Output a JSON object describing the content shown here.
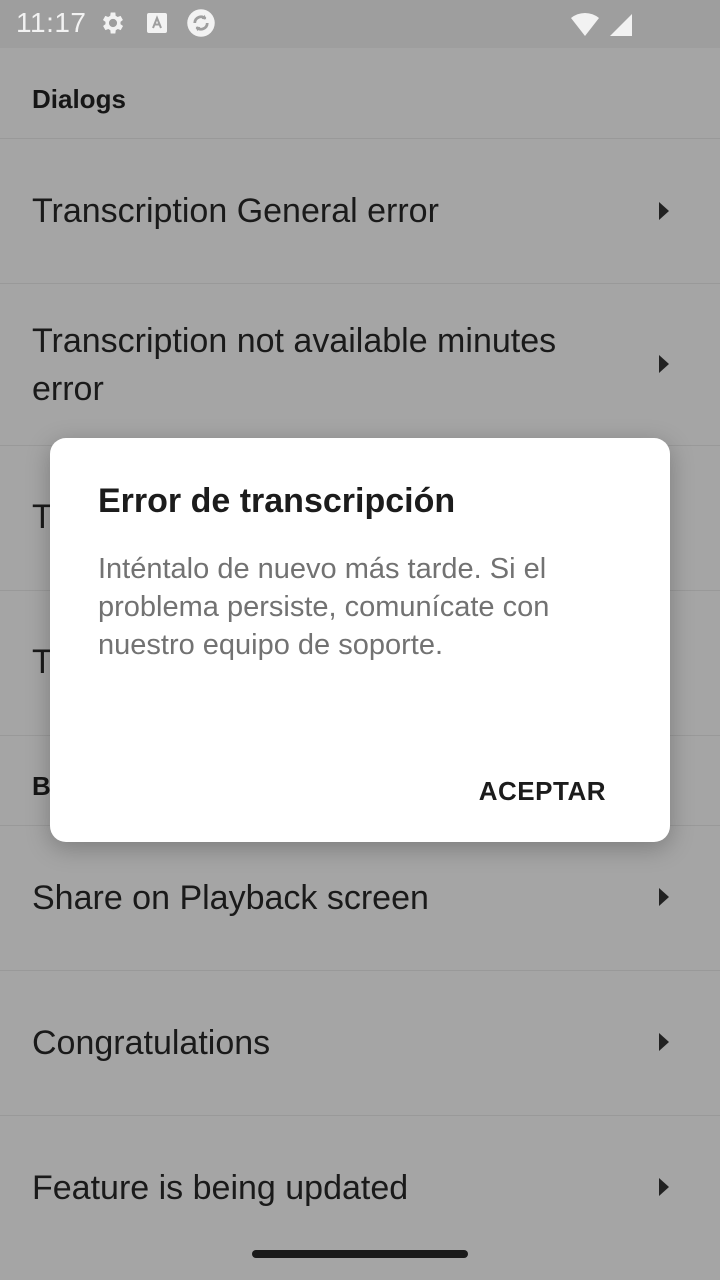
{
  "status_bar": {
    "time": "11:17",
    "icons_left": [
      "settings-gear-icon",
      "keyboard-a-icon",
      "sync-circle-icon"
    ],
    "icons_right": [
      "wifi-icon",
      "cell-signal-icon"
    ]
  },
  "list": {
    "categories": [
      {
        "label": "Dialogs"
      },
      {
        "label": "B"
      }
    ],
    "items": [
      {
        "label": "Transcription General error"
      },
      {
        "label": "Transcription not available minutes error"
      },
      {
        "label": "T"
      },
      {
        "label": "T"
      },
      {
        "label": "Share on Playback screen"
      },
      {
        "label": "Congratulations"
      },
      {
        "label": "Feature is being updated"
      }
    ]
  },
  "dialog": {
    "title": "Error de transcripción",
    "message": "Inténtalo de nuevo más tarde. Si el problema persiste, comunícate con nuestro equipo de soporte.",
    "ok_label": "ACEPTAR"
  },
  "colors": {
    "scrim": "#a5a5a5",
    "dialog_bg": "#ffffff",
    "message_text": "#727272"
  }
}
